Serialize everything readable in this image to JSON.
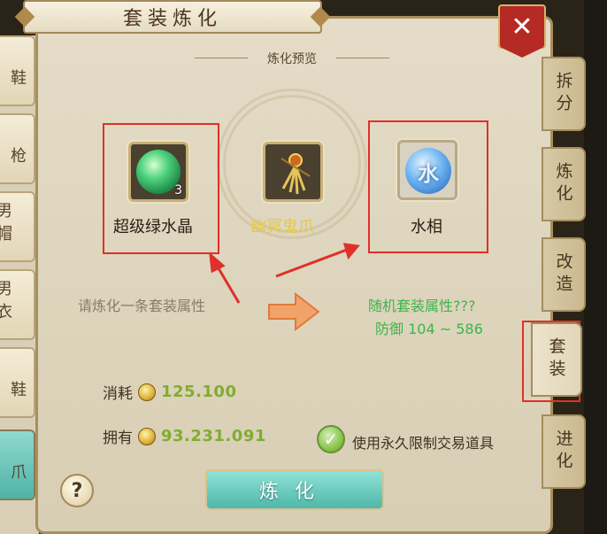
{
  "window": {
    "title": "套装炼化",
    "close_label": "✕"
  },
  "left_items": [
    {
      "label": "鞋"
    },
    {
      "label": "枪"
    },
    {
      "label": "男帽"
    },
    {
      "label": "男衣"
    },
    {
      "label": "鞋"
    },
    {
      "label": "爪"
    }
  ],
  "preview": {
    "header": "炼化预览",
    "material": {
      "name": "超级绿水晶",
      "count": "3",
      "label_color": "#2b2015"
    },
    "equipment": {
      "name": "幽冥鬼爪",
      "label_color": "#e3c94a"
    },
    "element": {
      "name": "水相",
      "glyph": "水",
      "label_color": "#2b2015"
    }
  },
  "refine": {
    "prompt": "请炼化一条套装属性",
    "random_attr": "随机套装属性???",
    "defense": "防御 104 ~ 586"
  },
  "cost": {
    "cost_label": "消耗",
    "cost_value": "125.100",
    "own_label": "拥有",
    "own_value": "93.231.091"
  },
  "option": {
    "checked": true,
    "label": "使用永久限制交易道具"
  },
  "buttons": {
    "help": "?",
    "refine": "炼化"
  },
  "tabs": [
    {
      "label": "拆分",
      "active": false
    },
    {
      "label": "炼化",
      "active": false
    },
    {
      "label": "改造",
      "active": false
    },
    {
      "label": "套装",
      "active": true
    },
    {
      "label": "进化",
      "active": false
    }
  ],
  "colors": {
    "annotation_red": "#e0302a",
    "green_text": "#3db54a",
    "refine_button": "#5cc3b6"
  }
}
